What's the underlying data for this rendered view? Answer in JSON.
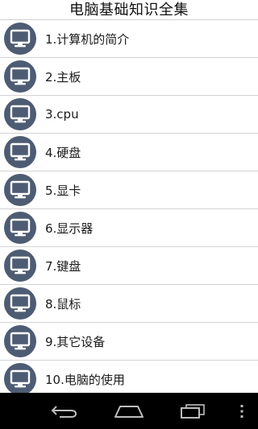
{
  "app": {
    "title": "电脑基础知识全集"
  },
  "list": {
    "items": [
      {
        "label": "1.计算机的简介",
        "icon": "monitor-icon"
      },
      {
        "label": "2.主板",
        "icon": "monitor-icon"
      },
      {
        "label": "3.cpu",
        "icon": "monitor-icon"
      },
      {
        "label": "4.硬盘",
        "icon": "monitor-icon"
      },
      {
        "label": "5.显卡",
        "icon": "monitor-icon"
      },
      {
        "label": "6.显示器",
        "icon": "monitor-icon"
      },
      {
        "label": "7.键盘",
        "icon": "monitor-icon"
      },
      {
        "label": "8.鼠标",
        "icon": "monitor-icon"
      },
      {
        "label": "9.其它设备",
        "icon": "monitor-icon"
      },
      {
        "label": "10.电脑的使用",
        "icon": "monitor-icon"
      }
    ]
  },
  "nav_bar": {
    "buttons": [
      "back-icon",
      "home-icon",
      "recent-apps-icon",
      "overflow-menu-icon"
    ]
  },
  "colors": {
    "icon_background": "#4e5c73",
    "divider": "#d3d3d3",
    "nav_bar": "#000000"
  }
}
